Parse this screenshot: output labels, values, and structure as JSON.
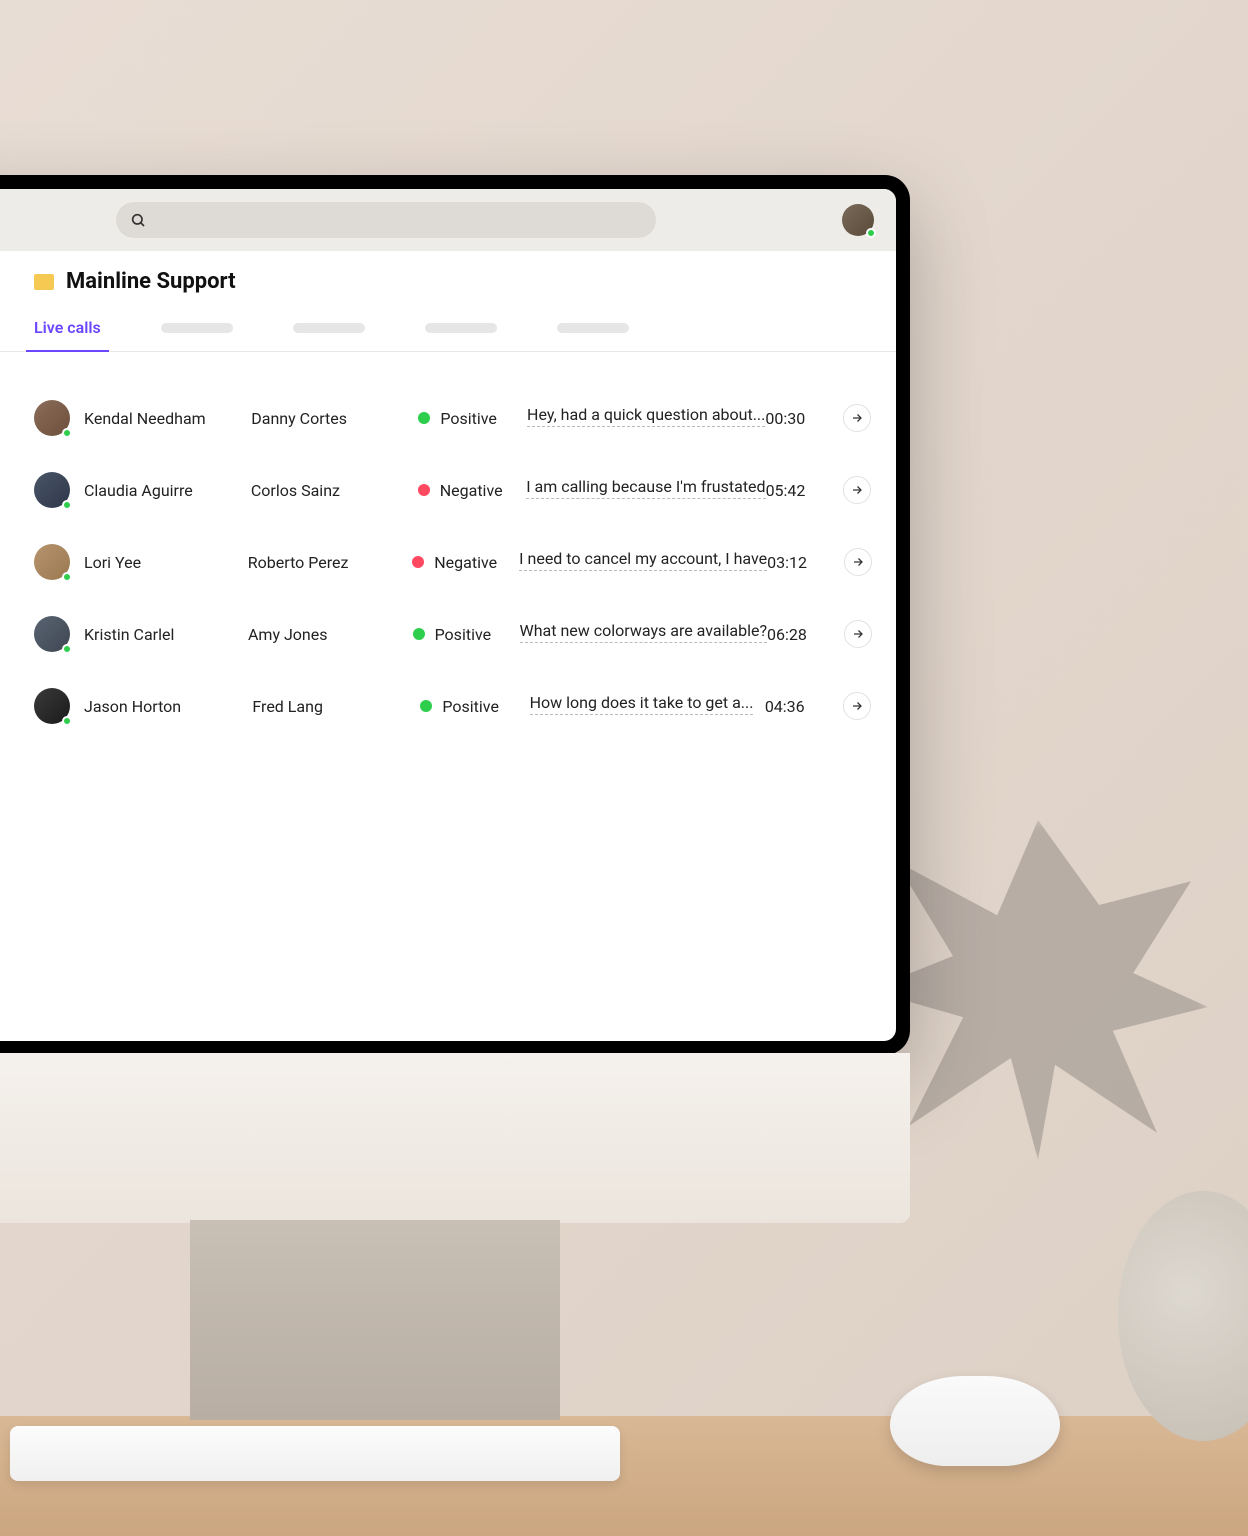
{
  "header": {
    "search_placeholder": ""
  },
  "page": {
    "title": "Mainline Support"
  },
  "tabs": {
    "active": "Live calls"
  },
  "sentiment_labels": {
    "positive": "Positive",
    "negative": "Negative"
  },
  "calls": [
    {
      "agent": "Kendal Needham",
      "customer": "Danny Cortes",
      "sentiment": "positive",
      "snippet": "Hey, had a quick question about...",
      "duration": "00:30"
    },
    {
      "agent": "Claudia Aguirre",
      "customer": "Corlos Sainz",
      "sentiment": "negative",
      "snippet": "I am calling because I'm frustated",
      "duration": "05:42"
    },
    {
      "agent": "Lori Yee",
      "customer": "Roberto Perez",
      "sentiment": "negative",
      "snippet": "I need to cancel my account, I have",
      "duration": "03:12"
    },
    {
      "agent": "Kristin Carlel",
      "customer": "Amy Jones",
      "sentiment": "positive",
      "snippet": "What new colorways are available?",
      "duration": "06:28"
    },
    {
      "agent": "Jason Horton",
      "customer": "Fred Lang",
      "sentiment": "positive",
      "snippet": "How long does it take to get a...",
      "duration": "04:36"
    }
  ]
}
